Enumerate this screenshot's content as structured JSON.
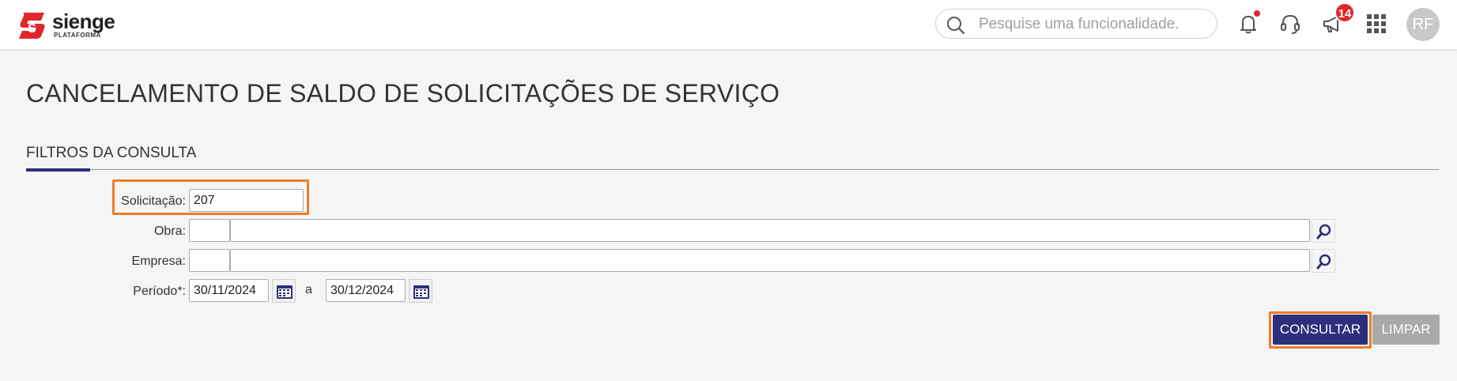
{
  "app": {
    "brand_name": "sienge",
    "brand_subtitle": "PLATAFORMA",
    "brand_color": "#e0262d"
  },
  "header": {
    "search_placeholder": "Pesquise uma funcionalidade.",
    "notifications_badge": "14",
    "user_initials": "RF",
    "icons": [
      "search-icon",
      "bell-icon",
      "headset-icon",
      "megaphone-icon",
      "apps-grid-icon"
    ]
  },
  "page": {
    "title": "CANCELAMENTO DE SALDO DE SOLICITAÇÕES DE SERVIÇO",
    "section_title": "FILTROS DA CONSULTA"
  },
  "form": {
    "solicitacao": {
      "label": "Solicitação:",
      "value": "207"
    },
    "obra": {
      "label": "Obra:",
      "code": "",
      "description": ""
    },
    "empresa": {
      "label": "Empresa:",
      "code": "",
      "description": ""
    },
    "periodo": {
      "label": "Período*:",
      "start": "30/11/2024",
      "separator": "a",
      "end": "30/12/2024"
    }
  },
  "actions": {
    "consultar_label": "CONSULTAR",
    "limpar_label": "LIMPAR"
  },
  "colors": {
    "primary": "#2d2f7a",
    "highlight": "#f07c26",
    "secondary_button": "#a9a9a9"
  }
}
